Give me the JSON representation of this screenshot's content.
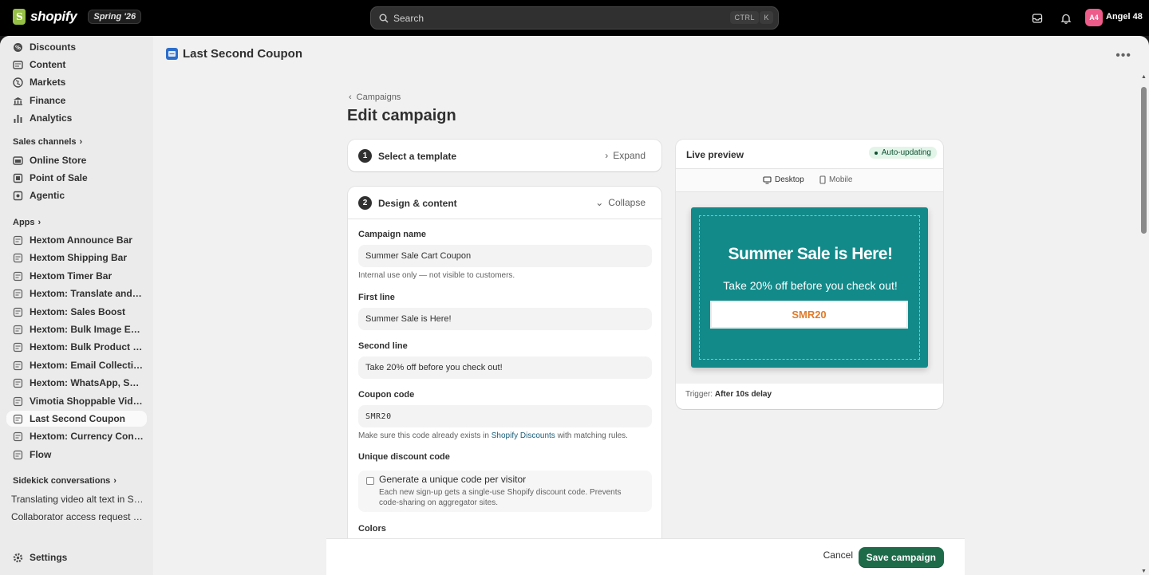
{
  "topbar": {
    "brand": "shopify",
    "edition": "Spring '26",
    "search_placeholder": "Search",
    "shortcut_ctrl": "CTRL",
    "shortcut_key": "K",
    "user_initials": "A4",
    "user_name": "Angel 48"
  },
  "sidebar": {
    "top_items": [
      {
        "label": "Discounts",
        "icon": "discount-icon"
      },
      {
        "label": "Content",
        "icon": "content-icon"
      },
      {
        "label": "Markets",
        "icon": "globe-icon"
      },
      {
        "label": "Finance",
        "icon": "bank-icon"
      },
      {
        "label": "Analytics",
        "icon": "chart-icon"
      }
    ],
    "sales_channels_label": "Sales channels",
    "channels": [
      {
        "label": "Online Store",
        "icon": "store-icon"
      },
      {
        "label": "Point of Sale",
        "icon": "pos-icon"
      },
      {
        "label": "Agentic",
        "icon": "agentic-icon"
      }
    ],
    "apps_label": "Apps",
    "apps": [
      {
        "label": "Hextom Announce Bar"
      },
      {
        "label": "Hextom Shipping Bar"
      },
      {
        "label": "Hextom Timer Bar"
      },
      {
        "label": "Hextom: Translate and Cur..."
      },
      {
        "label": "Hextom: Sales Boost"
      },
      {
        "label": "Hextom: Bulk Image Edit & ..."
      },
      {
        "label": "Hextom: Bulk Product Edit"
      },
      {
        "label": "Hextom: Email Collection B..."
      },
      {
        "label": "Hextom: WhatsApp, SMS ..."
      },
      {
        "label": "Vimotia Shoppable Videos ..."
      },
      {
        "label": "Last Second Coupon",
        "active": true
      },
      {
        "label": "Hextom: Currency Converter"
      },
      {
        "label": "Flow"
      }
    ],
    "sidekick_label": "Sidekick conversations",
    "conversations": [
      "Translating video alt text in Sho...",
      "Collaborator access request for..."
    ],
    "settings_label": "Settings"
  },
  "page": {
    "app_title": "Last Second Coupon",
    "breadcrumb": "Campaigns",
    "heading": "Edit campaign"
  },
  "step1": {
    "number": "1",
    "title": "Select a template",
    "action": "Expand"
  },
  "step2": {
    "number": "2",
    "title": "Design & content",
    "action": "Collapse",
    "campaign_name_label": "Campaign name",
    "campaign_name_value": "Summer Sale Cart Coupon",
    "campaign_name_help": "Internal use only — not visible to customers.",
    "first_line_label": "First line",
    "first_line_value": "Summer Sale is Here!",
    "second_line_label": "Second line",
    "second_line_value": "Take 20% off before you check out!",
    "coupon_code_label": "Coupon code",
    "coupon_code_value": "SMR20",
    "coupon_help_prefix": "Make sure this code already exists in",
    "coupon_help_link": "Shopify Discounts",
    "coupon_help_suffix": "with matching rules.",
    "unique_label": "Unique discount code",
    "unique_checkbox_title": "Generate a unique code per visitor",
    "unique_checkbox_desc": "Each new sign-up gets a single-use Shopify discount code. Prevents code-sharing on aggregator sites.",
    "colors_label": "Colors"
  },
  "preview": {
    "title": "Live preview",
    "status": "Auto-updating",
    "tab_desktop": "Desktop",
    "tab_mobile": "Mobile",
    "headline": "Summer Sale is Here!",
    "subline": "Take 20% off before you check out!",
    "code": "SMR20",
    "trigger_label": "Trigger:",
    "trigger_value": "After 10s delay",
    "colors": {
      "background": "#138a8a",
      "code_text": "#e07b2a"
    }
  },
  "footer": {
    "cancel": "Cancel",
    "save": "Save campaign"
  }
}
